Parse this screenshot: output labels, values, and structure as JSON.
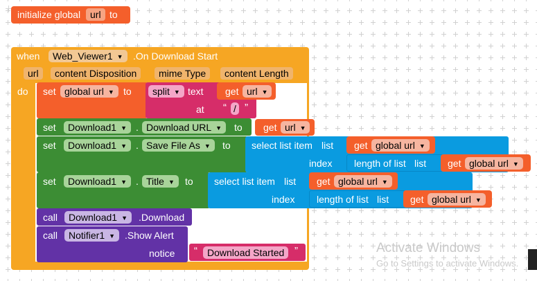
{
  "global_init": {
    "label": "initialize global",
    "var_name": "url",
    "to": "to"
  },
  "event": {
    "when": "when",
    "component": "Web_Viewer1",
    "event_name": ".On Download Start",
    "params": [
      "url",
      "content Disposition",
      "mime Type",
      "content Length"
    ],
    "do": "do"
  },
  "statements": {
    "set_global": {
      "set": "set",
      "var": "global url",
      "to": "to",
      "split": "split",
      "text": "text",
      "get": "get",
      "get_var": "url",
      "at": "at",
      "sep": "/"
    },
    "set_url": {
      "set": "set",
      "component": "Download1",
      "property": "Download URL",
      "to": "to",
      "get": "get",
      "get_var": "url"
    },
    "set_save": {
      "set": "set",
      "component": "Download1",
      "property": "Save File As",
      "to": "to",
      "select": "select list item",
      "list": "list",
      "get": "get",
      "get_var": "global url",
      "index": "index",
      "length": "length of list",
      "list2": "list",
      "get2": "get",
      "get_var2": "global url"
    },
    "set_title": {
      "set": "set",
      "component": "Download1",
      "property": "Title",
      "to": "to",
      "select": "select list item",
      "list": "list",
      "get": "get",
      "get_var": "global url",
      "index": "index",
      "length": "length of list",
      "list2": "list",
      "get2": "get",
      "get_var2": "global url"
    },
    "call_download": {
      "call": "call",
      "component": "Download1",
      "method": ".Download"
    },
    "call_alert": {
      "call": "call",
      "component": "Notifier1",
      "method": ".Show Alert",
      "notice": "notice",
      "message": "Download Started"
    }
  },
  "watermark": {
    "line1": "Activate Windows",
    "line2": "Go to Settings to activate Windows."
  },
  "colors": {
    "event": "#f6a623",
    "set_var": "#f45f2b",
    "text": "#d62d69",
    "component": "#3c8d34",
    "list": "#0a9be0",
    "call": "#6232a6"
  }
}
